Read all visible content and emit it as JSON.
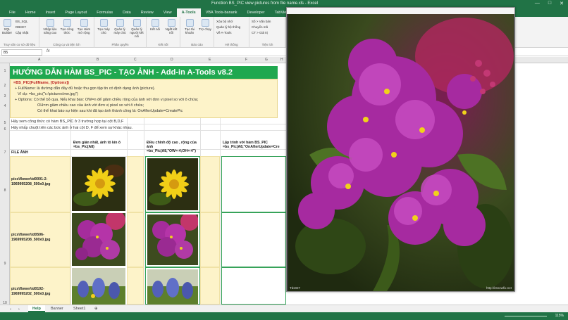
{
  "window": {
    "title": "Function BS_PIC view pictures from file name.xls - Excel",
    "min": "—",
    "max": "□",
    "close": "✕"
  },
  "ribbon_tabs": [
    "File",
    "Home",
    "Insert",
    "Page Layout",
    "Formulas",
    "Data",
    "Review",
    "View",
    "A-Tools",
    "VBA Tools-banank",
    "Developer",
    "TabView"
  ],
  "active_tab": "A-Tools",
  "ribbon": {
    "groups": [
      {
        "label": "Truy vấn cơ sở dữ liệu",
        "buttons": [
          "SQL Builder",
          "BS_SQL",
          "DBKEY",
          "Cập nhật"
        ]
      },
      {
        "label": "Công cụ và tiện ích",
        "buttons": [
          "Nhập liệu nâng cao",
          "Tạo công thức",
          "Tạo Hàm mở rộng"
        ]
      },
      {
        "label": "Phân quyền",
        "buttons": [
          "Tạo máy chủ",
          "Quản lý máy chủ",
          "Quản lý người kết nối"
        ]
      },
      {
        "label": "Kết nối",
        "buttons": [
          "Kết nối",
          "Ngắt kết nối"
        ]
      },
      {
        "label": "Báo cáo",
        "buttons": [
          "Tạo tài khoản",
          "Trợ chạy"
        ]
      },
      {
        "label": "Hệ thống",
        "buttons": [
          "Xóa bộ nhớ",
          "Quản lý hệ thống",
          "Về A-Tools"
        ]
      },
      {
        "label": "Tiện ích",
        "buttons": [
          "Số > Văn bản",
          "Chuyển mã",
          "CT > Giá trị"
        ]
      }
    ]
  },
  "formula_bar": {
    "name_box": "B5",
    "fx": "fx"
  },
  "columns": [
    "A",
    "B",
    "C",
    "D",
    "E",
    "F",
    "G",
    "H"
  ],
  "rows": [
    "1",
    "2",
    "3",
    "4",
    "5",
    "6",
    "7",
    "8",
    "9",
    "10"
  ],
  "sheet": {
    "banner": "HƯỚNG DẪN HÀM BS_PIC - TẠO ẢNH - Add-in A-Tools v8.2",
    "syntax": "=BS_PIC(FullName, [Options])",
    "desc_fullname": "+ FullName: là đường dẫn đầy đủ hoặc thu gọn tập tin có định dạng ảnh (picture).",
    "example": "Ví dụ: =bs_pic(\"c:\\pictures\\me.jpg\")",
    "desc_options": "+ Options: Có thể bỏ qua. Nếu khai báo: OW=n để giảm chiều rộng của ảnh với đơn vị pixel so với ô chứa;",
    "desc_oh": "OH=m giảm chiều cao của ảnh với  đơn vị pixel so với ô chứa;",
    "desc_update": "Có thể khai báo sự kiện sau khi đã tạo ảnh thành công là: OnAfterUpdate=CreatePic",
    "line5": "Hãy xem  công thức có hàm BS_PIC ở 3 trường hợp tại cột B,D,F",
    "line6": "Hãy nhấp chuột trên các bức ảnh ở hai cột D, F để xem sự khác nhau.",
    "col_file": "FILE ẢNH",
    "col_b": "Đơn giản nhất, ảnh tỏ kín ô =bs_Pic(A8)",
    "col_d": "Điều chỉnh độ cao , rộng của ảnh =bs_Pic(A8,\"OW=-4;OH=-4\")",
    "col_f": "Lập trình với hàm BS_PIC =bs_Pic(A8,\"OnAfterUpdate=Cre",
    "files": [
      "pics\\flower\\td0001-2-1969995208_500x0.jpg",
      "pics\\flower\\td0506-1969995208_500x0.jpg",
      "pics\\flower\\td0102-1969995202_500x0.jpg"
    ]
  },
  "picture_window": {
    "caption_left": "Tds027",
    "caption_right": "http://itsnewfix.net"
  },
  "sheet_tabs": [
    "Help",
    "Banner",
    "Sheet1"
  ],
  "active_sheet": "Help",
  "status": {
    "zoom": "115%"
  },
  "colors": {
    "excel_green": "#217346",
    "banner_green": "#1fa84f",
    "note_yellow": "#fdf3c9",
    "flower_purple": "#a0299a"
  }
}
